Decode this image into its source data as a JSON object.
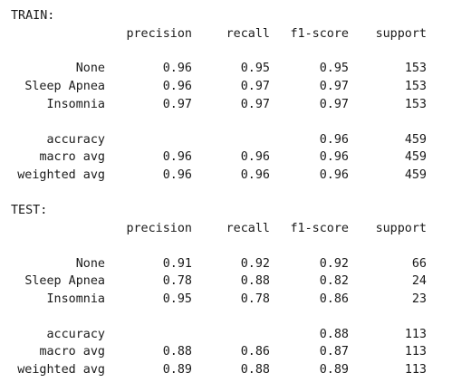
{
  "train": {
    "title": "TRAIN:",
    "headers": [
      "precision",
      "recall",
      "f1-score",
      "support"
    ],
    "classes": [
      {
        "label": "None",
        "precision": "0.96",
        "recall": "0.95",
        "f1": "0.95",
        "support": "153"
      },
      {
        "label": "Sleep Apnea",
        "precision": "0.96",
        "recall": "0.97",
        "f1": "0.97",
        "support": "153"
      },
      {
        "label": "Insomnia",
        "precision": "0.97",
        "recall": "0.97",
        "f1": "0.97",
        "support": "153"
      }
    ],
    "summary": [
      {
        "label": "accuracy",
        "precision": "",
        "recall": "",
        "f1": "0.96",
        "support": "459"
      },
      {
        "label": "macro avg",
        "precision": "0.96",
        "recall": "0.96",
        "f1": "0.96",
        "support": "459"
      },
      {
        "label": "weighted avg",
        "precision": "0.96",
        "recall": "0.96",
        "f1": "0.96",
        "support": "459"
      }
    ]
  },
  "test": {
    "title": "TEST:",
    "headers": [
      "precision",
      "recall",
      "f1-score",
      "support"
    ],
    "classes": [
      {
        "label": "None",
        "precision": "0.91",
        "recall": "0.92",
        "f1": "0.92",
        "support": "66"
      },
      {
        "label": "Sleep Apnea",
        "precision": "0.78",
        "recall": "0.88",
        "f1": "0.82",
        "support": "24"
      },
      {
        "label": "Insomnia",
        "precision": "0.95",
        "recall": "0.78",
        "f1": "0.86",
        "support": "23"
      }
    ],
    "summary": [
      {
        "label": "accuracy",
        "precision": "",
        "recall": "",
        "f1": "0.88",
        "support": "113"
      },
      {
        "label": "macro avg",
        "precision": "0.88",
        "recall": "0.86",
        "f1": "0.87",
        "support": "113"
      },
      {
        "label": "weighted avg",
        "precision": "0.89",
        "recall": "0.88",
        "f1": "0.89",
        "support": "113"
      }
    ]
  }
}
